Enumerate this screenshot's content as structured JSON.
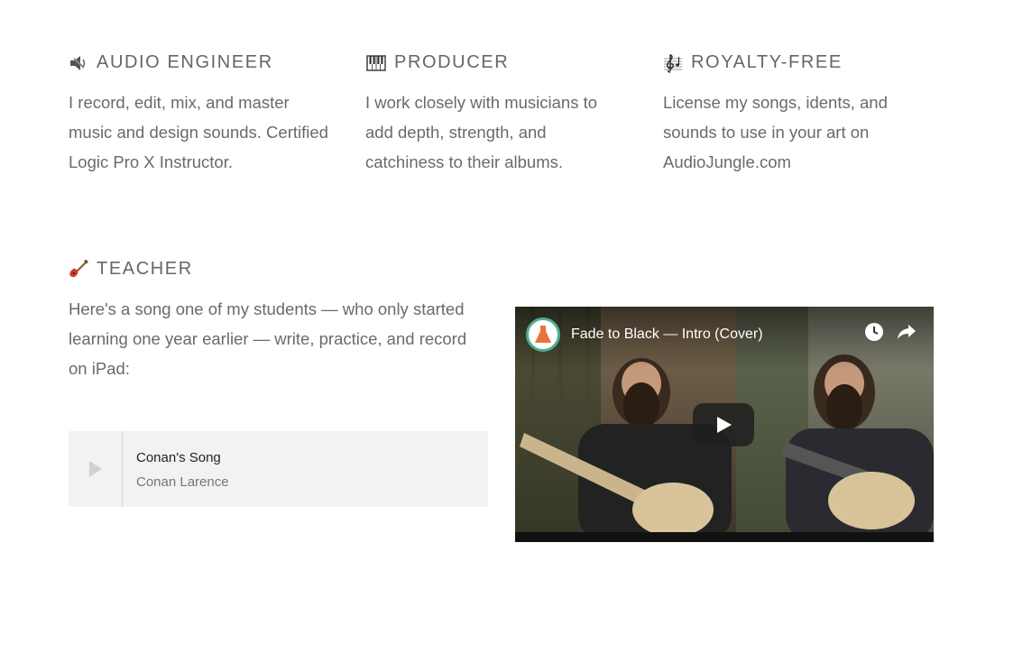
{
  "sections": [
    {
      "heading": "AUDIO ENGINEER",
      "icon": "speaker-icon",
      "text": [
        "I record, edit, mix, and master",
        "music and design sounds. Certified",
        "Logic Pro X Instructor."
      ]
    },
    {
      "heading": "PRODUCER",
      "icon": "piano-keys-icon",
      "text": [
        "I work closely with musicians to",
        "add depth, strength, and",
        "catchiness to their albums."
      ]
    },
    {
      "heading": "ROYALTY-FREE",
      "icon": "treble-clef-icon",
      "text": [
        "License my songs, idents, and",
        "sounds to use in your art on",
        "AudioJungle.com"
      ]
    }
  ],
  "teacher": {
    "heading": "TEACHER",
    "icon": "guitar-icon",
    "text": [
      "Here's a song one of my students — who only started",
      "learning one year earlier — write, practice, and record",
      "on iPad:"
    ]
  },
  "player": {
    "title": "Conan's Song",
    "artist": "Conan Larence"
  },
  "video": {
    "title": "Fade to Black — Intro (Cover)",
    "channel_icon": "flask-icon",
    "controls": [
      "watch-later-icon",
      "share-icon"
    ]
  },
  "colors": {
    "text": "#666666",
    "player_bg": "#f2f2f2",
    "accent": "#4caf8f",
    "flask": "#e8733a"
  }
}
